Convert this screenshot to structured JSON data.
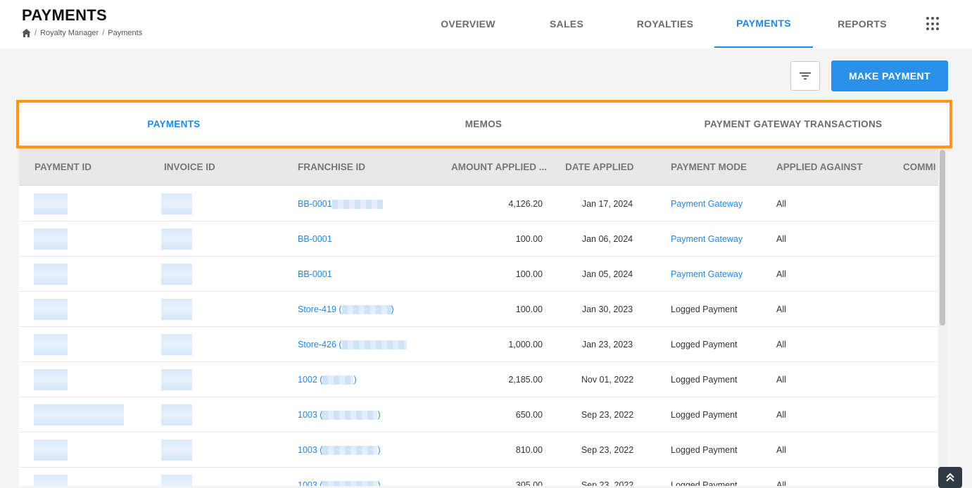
{
  "header": {
    "title": "PAYMENTS",
    "breadcrumb": [
      "Royalty Manager",
      "Payments"
    ],
    "nav": [
      {
        "label": "OVERVIEW"
      },
      {
        "label": "SALES"
      },
      {
        "label": "ROYALTIES"
      },
      {
        "label": "PAYMENTS",
        "active": true
      },
      {
        "label": "REPORTS"
      }
    ]
  },
  "toolbar": {
    "make_payment_label": "MAKE PAYMENT"
  },
  "subtabs": [
    {
      "label": "PAYMENTS",
      "active": true
    },
    {
      "label": "MEMOS"
    },
    {
      "label": "PAYMENT GATEWAY TRANSACTIONS"
    }
  ],
  "table": {
    "columns": [
      "PAYMENT ID",
      "INVOICE ID",
      "FRANCHISE ID",
      "AMOUNT APPLIED ...",
      "DATE APPLIED",
      "PAYMENT MODE",
      "APPLIED AGAINST",
      "COMMI"
    ],
    "rows": [
      {
        "franchise": "BB-0001",
        "amount": "4,126.20",
        "date": "Jan 17, 2024",
        "mode": "Payment Gateway",
        "against": "All"
      },
      {
        "franchise": "BB-0001",
        "amount": "100.00",
        "date": "Jan 06, 2024",
        "mode": "Payment Gateway",
        "against": "All"
      },
      {
        "franchise": "BB-0001",
        "amount": "100.00",
        "date": "Jan 05, 2024",
        "mode": "Payment Gateway",
        "against": "All"
      },
      {
        "franchise": "Store-419 (",
        "franchise_suffix": ")",
        "amount": "100.00",
        "date": "Jan 30, 2023",
        "mode": "Logged Payment",
        "against": "All"
      },
      {
        "franchise": "Store-426 (",
        "franchise_suffix": "",
        "amount": "1,000.00",
        "date": "Jan 23, 2023",
        "mode": "Logged Payment",
        "against": "All"
      },
      {
        "franchise": "1002 (",
        "franchise_suffix": ")",
        "amount": "2,185.00",
        "date": "Nov 01, 2022",
        "mode": "Logged Payment",
        "against": "All"
      },
      {
        "franchise": "1003 (",
        "franchise_suffix": ")",
        "amount": "650.00",
        "date": "Sep 23, 2022",
        "mode": "Logged Payment",
        "against": "All"
      },
      {
        "franchise": "1003 (",
        "franchise_suffix": ")",
        "amount": "810.00",
        "date": "Sep 23, 2022",
        "mode": "Logged Payment",
        "against": "All"
      },
      {
        "franchise": "1003 (",
        "franchise_suffix": ")",
        "amount": "305.00",
        "date": "Sep 23, 2022",
        "mode": "Logged Payment",
        "against": "All"
      }
    ]
  }
}
